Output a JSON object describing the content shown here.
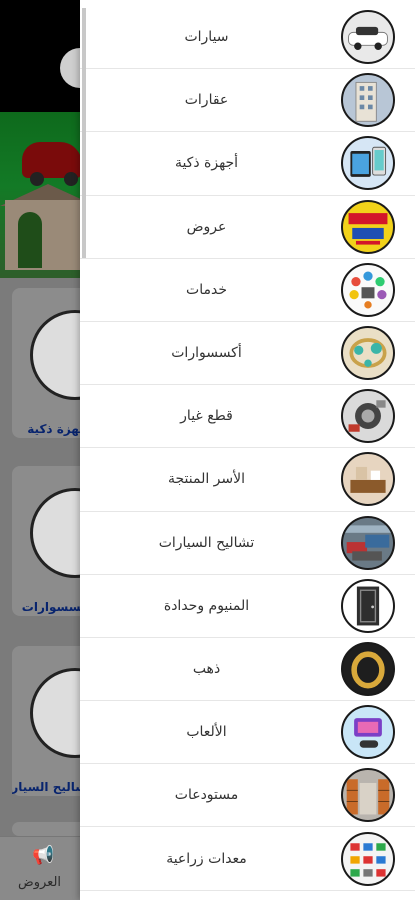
{
  "background": {
    "cards": [
      {
        "label": "أجهزة ذكية"
      },
      {
        "label": "اكسسوارات"
      },
      {
        "label": "تشاليح السيارات"
      }
    ],
    "bottom_nav": {
      "offers_label": "العروض"
    }
  },
  "drawer": {
    "items": [
      {
        "label": "سيارات",
        "icon": "car-icon",
        "color": "#e9e9e9"
      },
      {
        "label": "عقارات",
        "icon": "building-icon",
        "color": "#b8c6d6"
      },
      {
        "label": "أجهزة ذكية",
        "icon": "smartphone-icon",
        "color": "#d6e6f5"
      },
      {
        "label": "عروض",
        "icon": "offers-icon",
        "color": "#f2d21a"
      },
      {
        "label": "خدمات",
        "icon": "services-icon",
        "color": "#fafafa"
      },
      {
        "label": "أكسسوارات",
        "icon": "bracelet-icon",
        "color": "#eadfc6"
      },
      {
        "label": "قطع غيار",
        "icon": "spare-parts-icon",
        "color": "#dadada"
      },
      {
        "label": "الأسر المنتجة",
        "icon": "productive-families-icon",
        "color": "#e7d5c0"
      },
      {
        "label": "تشاليح السيارات",
        "icon": "scrap-cars-icon",
        "color": "#6a7a86"
      },
      {
        "label": "المنيوم وحدادة",
        "icon": "aluminium-door-icon",
        "color": "#3a3a3a"
      },
      {
        "label": "ذهب",
        "icon": "gold-ring-icon",
        "color": "#e9d3a0"
      },
      {
        "label": "الألعاب",
        "icon": "games-icon",
        "color": "#c9e6f7"
      },
      {
        "label": "مستودعات",
        "icon": "warehouse-icon",
        "color": "#b9b4ae"
      },
      {
        "label": "معدات زراعية",
        "icon": "agri-equipment-icon",
        "color": "#f4f4f4"
      }
    ]
  }
}
